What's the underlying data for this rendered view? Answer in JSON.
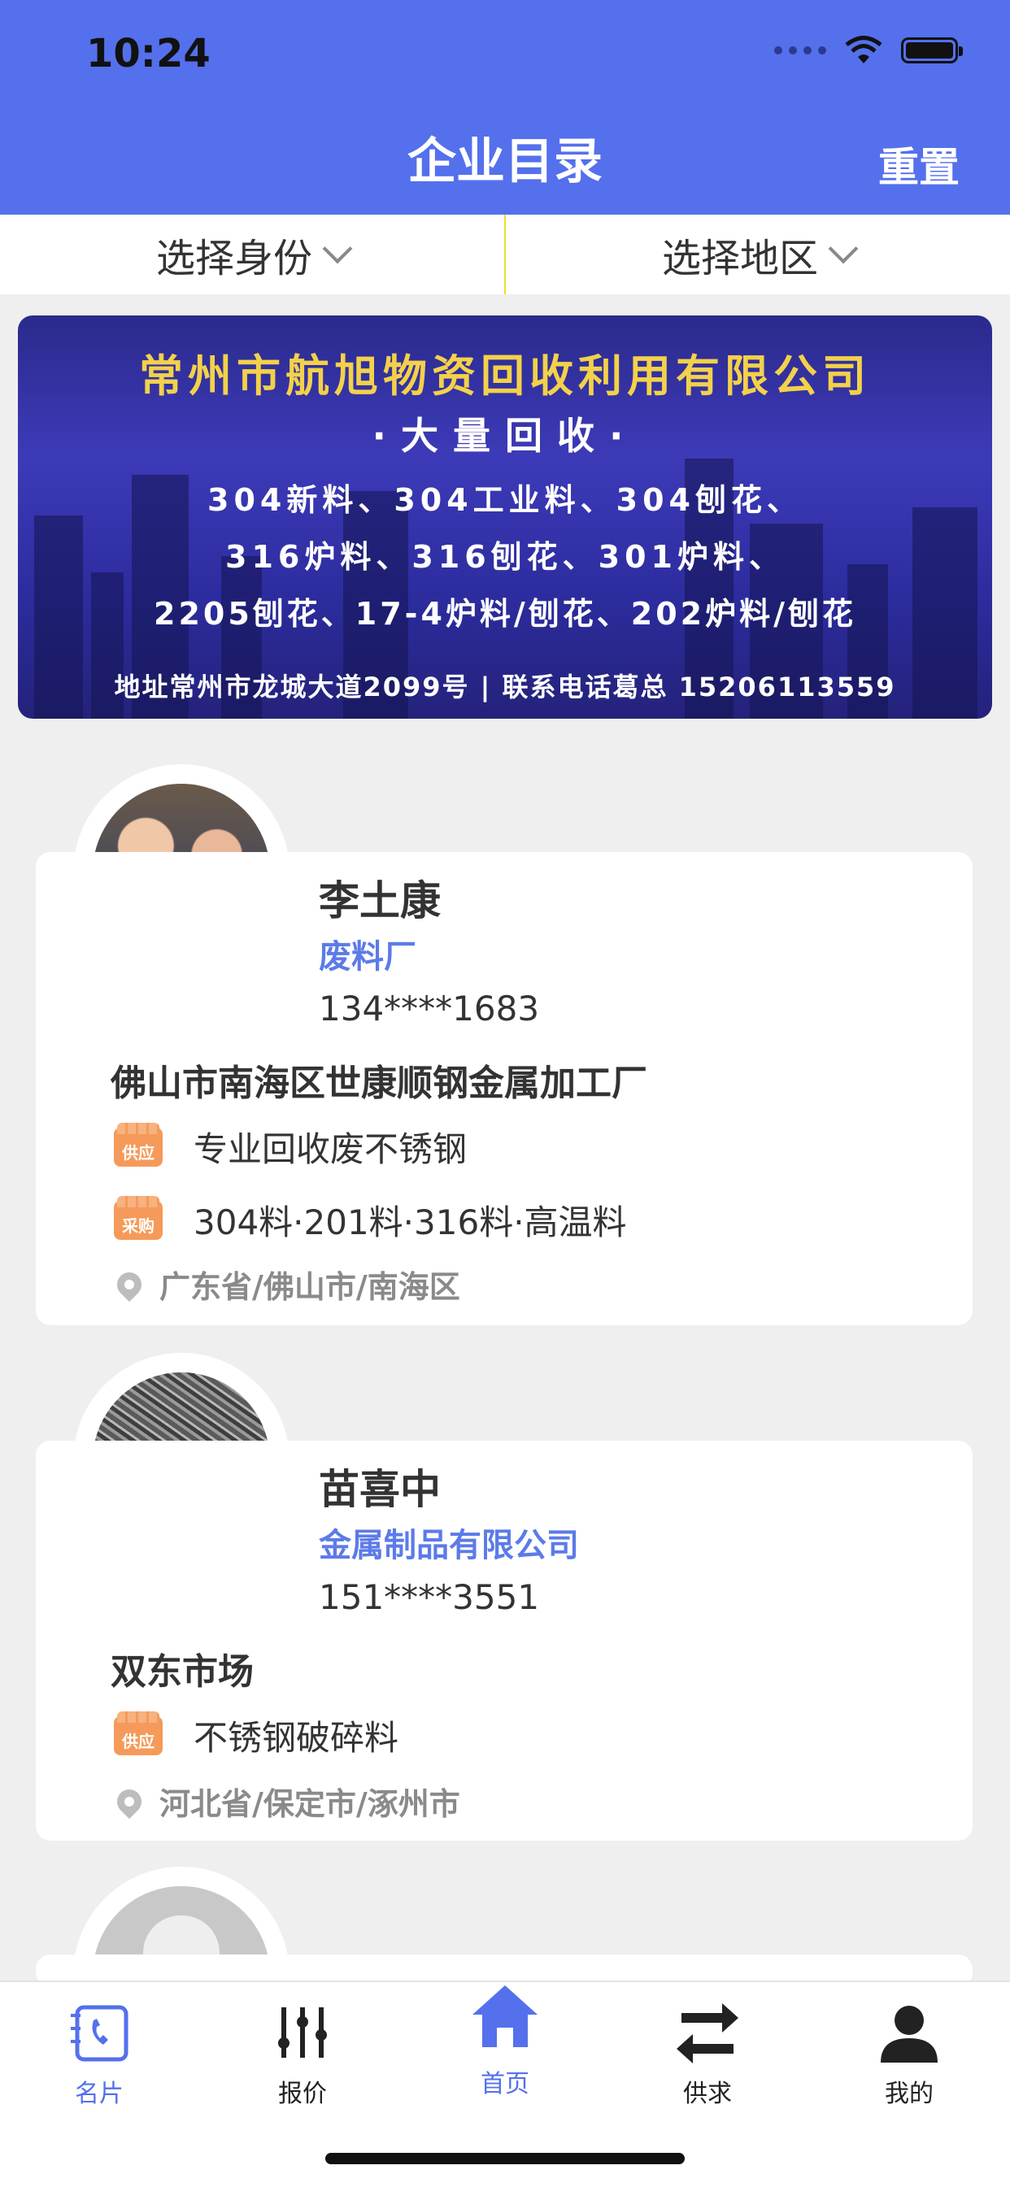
{
  "status": {
    "time": "10:24"
  },
  "header": {
    "title": "企业目录",
    "reset_label": "重置"
  },
  "filters": {
    "identity_label": "选择身份",
    "region_label": "选择地区"
  },
  "banner": {
    "line1": "常州市航旭物资回收利用有限公司",
    "line2": "·大量回收·",
    "line3": "304新料、304工业料、304刨花、",
    "line4": "316炉料、316刨花、301炉料、",
    "line5": "2205刨花、17-4炉料/刨花、202炉料/刨花",
    "line6": "地址常州市龙城大道2099号 | 联系电话葛总 15206113559"
  },
  "cards": [
    {
      "name": "李土康",
      "role": "废料厂",
      "phone": "134****1683",
      "company": "佛山市南海区世康顺钢金属加工厂",
      "supply_badge": "供应",
      "supply": "专业回收废不锈钢",
      "purchase_badge": "采购",
      "purchase": "304料·201料·316料·高温料",
      "location": "广东省/佛山市/南海区"
    },
    {
      "name": "苗喜中",
      "role": "金属制品有限公司",
      "phone": "151****3551",
      "company": "双东市场",
      "supply_badge": "供应",
      "supply": "不锈钢破碎料",
      "location": "河北省/保定市/涿州市"
    }
  ],
  "tabbar": {
    "items": [
      {
        "label": "名片",
        "icon": "card-phone-icon"
      },
      {
        "label": "报价",
        "icon": "sliders-icon"
      },
      {
        "label": "首页",
        "icon": "home-icon"
      },
      {
        "label": "供求",
        "icon": "exchange-icon"
      },
      {
        "label": "我的",
        "icon": "user-icon"
      }
    ]
  },
  "colors": {
    "primary": "#5470ec",
    "accent_orange": "#f59a5a",
    "banner_yellow": "#f3d14a"
  }
}
